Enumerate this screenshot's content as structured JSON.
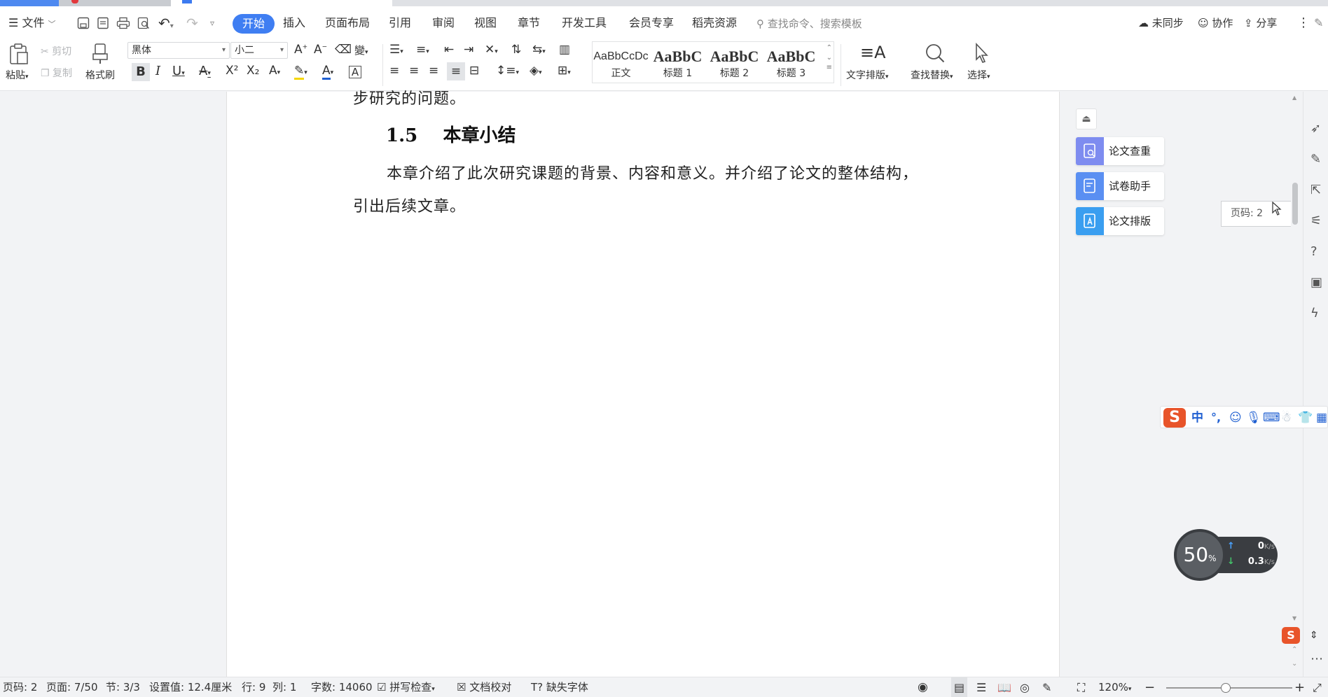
{
  "menubar": {
    "file": "文件",
    "tabs": [
      "开始",
      "插入",
      "页面布局",
      "引用",
      "审阅",
      "视图",
      "章节",
      "开发工具",
      "会员专享",
      "稻壳资源"
    ],
    "search_placeholder": "查找命令、搜索模板",
    "sync": "未同步",
    "collab": "协作",
    "share": "分享"
  },
  "ribbon": {
    "paste": "粘贴",
    "cut": "剪切",
    "copy": "复制",
    "format_painter": "格式刷",
    "font_name": "黑体",
    "font_size": "小二",
    "styles": [
      {
        "preview": "AaBbCcDc",
        "label": "正文"
      },
      {
        "preview": "AaBbC",
        "label": "标题 1"
      },
      {
        "preview": "AaBbC",
        "label": "标题 2"
      },
      {
        "preview": "AaBbC",
        "label": "标题 3"
      }
    ],
    "text_layout": "文字排版",
    "find_replace": "查找替换",
    "select": "选择"
  },
  "document": {
    "top_fragment": "步研究的问题。",
    "heading": "1.5    本章小结",
    "para_line1": "本章介绍了此次研究课题的背景、内容和意义。并介绍了论文的整体结构，",
    "para_line2": "引出后续文章。"
  },
  "panel": {
    "tools": [
      "论文查重",
      "试卷助手",
      "论文排版"
    ],
    "tooltip": "页码: 2"
  },
  "ime": {
    "lang": "中"
  },
  "network": {
    "percent": "50",
    "percent_unit": "%",
    "up": "0",
    "down": "0.3",
    "unit": "K/s"
  },
  "status": {
    "page_no": "页码: 2",
    "page": "页面: 7/50",
    "section": "节: 3/3",
    "setting": "设置值: 12.4厘米",
    "row": "行: 9",
    "col": "列: 1",
    "words": "字数: 14060",
    "spell": "拼写检查",
    "proof": "文档校对",
    "missing_font": "缺失字体",
    "zoom": "120%"
  }
}
